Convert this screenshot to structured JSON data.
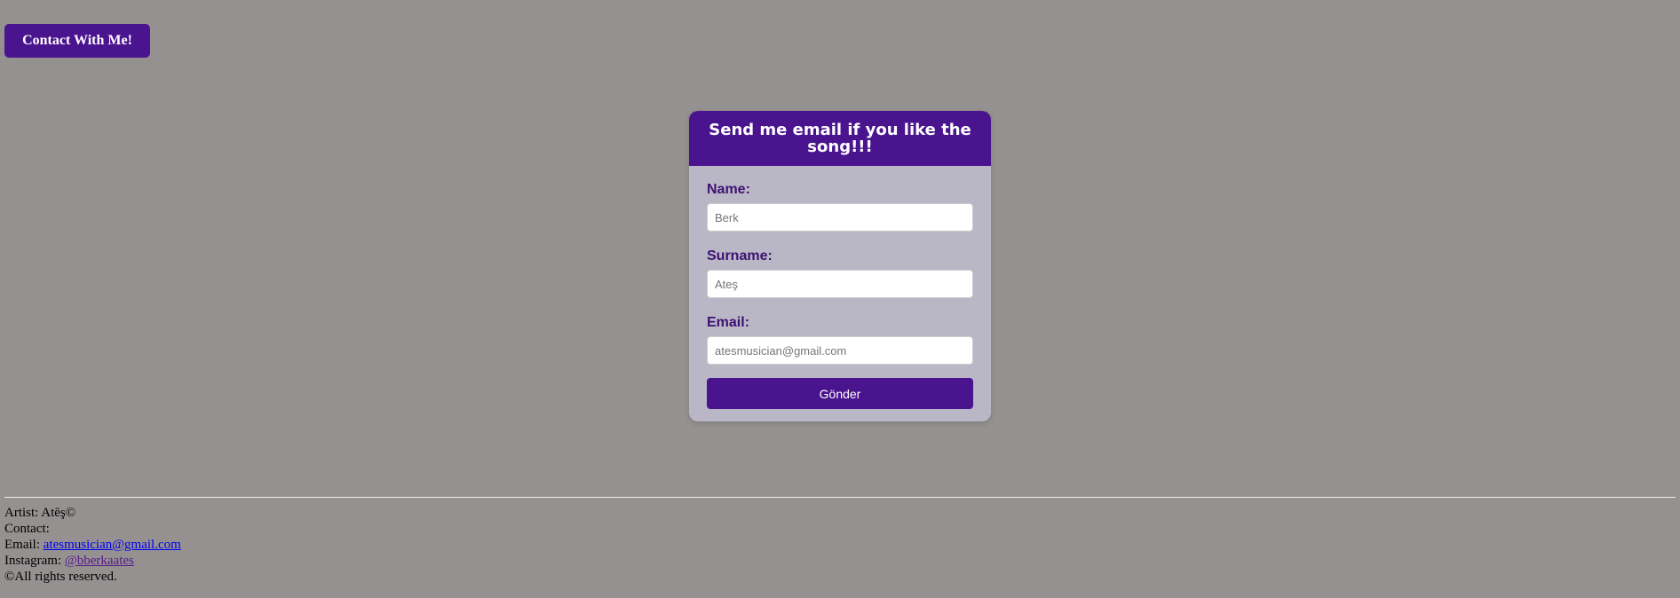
{
  "contact_button": {
    "label": "Contact With Me!"
  },
  "form": {
    "title": "Send me email if you like the song!!!",
    "fields": [
      {
        "label": "Name:",
        "placeholder": "Berk"
      },
      {
        "label": "Surname:",
        "placeholder": "Ateş"
      },
      {
        "label": "Email:",
        "placeholder": "atesmusician@gmail.com"
      }
    ],
    "submit_label": "Gönder"
  },
  "footer": {
    "artist_prefix": "Artist:",
    "artist_name": "Atēş©",
    "contact_label": "Contact:",
    "email_prefix": "Email:",
    "email_link": "atesmusician@gmail.com",
    "instagram_prefix": "Instagram:",
    "instagram_link": "@bberkaates",
    "rights": "©All rights reserved."
  },
  "colors": {
    "page_background": "#959191",
    "accent": "#4b148f",
    "card_background": "#b9b7c6",
    "label_text": "#3d1170"
  }
}
